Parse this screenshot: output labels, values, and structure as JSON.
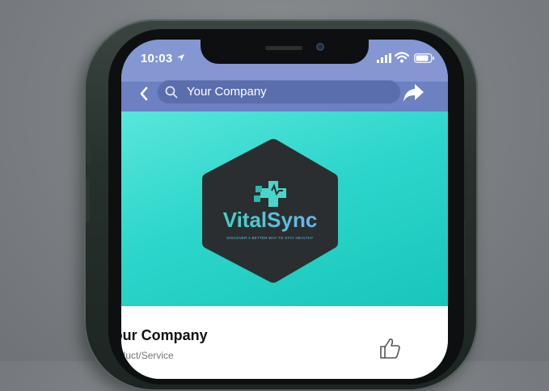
{
  "status_bar": {
    "time": "10:03"
  },
  "header": {
    "search_text": "Your Company"
  },
  "logo": {
    "name": "VitalSync",
    "tagline": "DISCOVER A BETTER WAY TO STAY HEALTHY"
  },
  "profile": {
    "name": "Your Company",
    "category": "Product/Service"
  },
  "colors": {
    "nav_blue": "#6c80c2",
    "cover_teal": "#2dd6cb",
    "logo_hex": "#2b2e30",
    "logo_accent": "#43d4c8"
  }
}
